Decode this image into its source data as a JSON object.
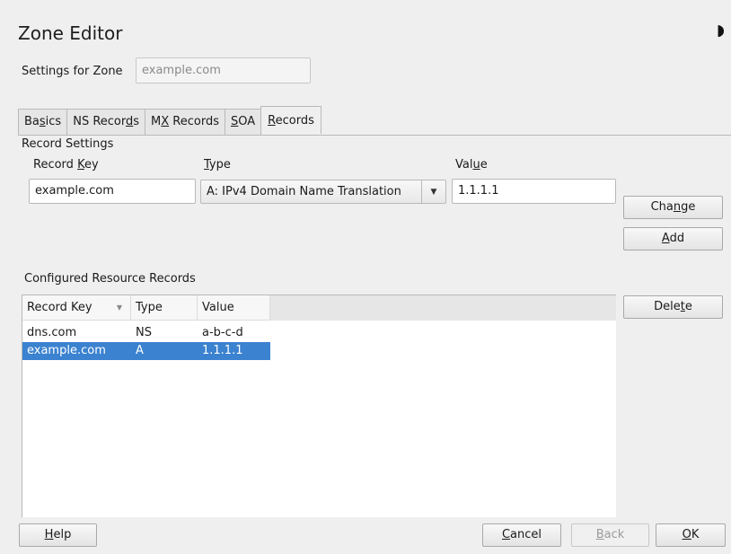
{
  "window": {
    "title": "Zone Editor",
    "corner_icon": "moon-icon"
  },
  "zone": {
    "label": "Settings for Zone",
    "value": "example.com"
  },
  "tabs": [
    {
      "pre": "Ba",
      "u": "s",
      "post": "ics"
    },
    {
      "pre": "NS Recor",
      "u": "d",
      "post": "s"
    },
    {
      "pre": "M",
      "u": "X",
      "post": " Records"
    },
    {
      "pre": "",
      "u": "S",
      "post": "OA"
    },
    {
      "pre": "",
      "u": "R",
      "post": "ecords"
    }
  ],
  "record_settings": {
    "heading": "Record Settings",
    "key_label": {
      "pre": "Record ",
      "u": "K",
      "post": "ey"
    },
    "key_value": "example.com",
    "type_label": {
      "pre": "",
      "u": "T",
      "post": "ype"
    },
    "type_value": "A: IPv4 Domain Name Translation",
    "value_label": {
      "pre": "Val",
      "u": "u",
      "post": "e"
    },
    "value_value": "1.1.1.1",
    "change_btn": {
      "pre": "Cha",
      "u": "n",
      "post": "ge"
    },
    "add_btn": {
      "pre": "",
      "u": "A",
      "post": "dd"
    }
  },
  "configured": {
    "heading": "Configured Resource Records",
    "columns": [
      "Record Key",
      "Type",
      "Value"
    ],
    "rows": [
      {
        "key": "dns.com",
        "type": "NS",
        "value": "a-b-c-d",
        "selected": false
      },
      {
        "key": "example.com",
        "type": "A",
        "value": "1.1.1.1",
        "selected": true
      }
    ],
    "delete_btn": {
      "pre": "Dele",
      "u": "t",
      "post": "e"
    }
  },
  "footer": {
    "help": {
      "pre": "",
      "u": "H",
      "post": "elp"
    },
    "cancel": {
      "pre": "",
      "u": "C",
      "post": "ancel"
    },
    "back": {
      "pre": "",
      "u": "B",
      "post": "ack"
    },
    "ok": {
      "pre": "",
      "u": "O",
      "post": "K"
    }
  },
  "colors": {
    "selection": "#3b82d0",
    "background": "#efefef"
  }
}
